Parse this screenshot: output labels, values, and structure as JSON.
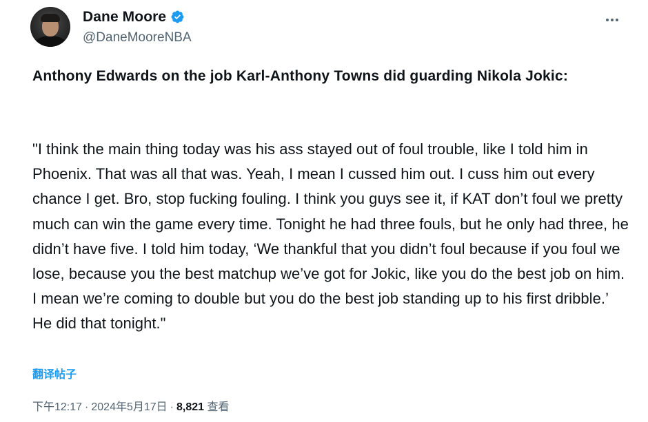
{
  "author": {
    "display_name": "Dane Moore",
    "handle": "@DaneMooreNBA",
    "verified_color": "#1d9bf0"
  },
  "tweet": {
    "headline": "Anthony Edwards on the job Karl-Anthony Towns did guarding Nikola Jokic:",
    "quote": "\"I think the main thing today was his ass stayed out of foul trouble, like I told him in Phoenix. That was all that was. Yeah, I mean I cussed him out. I cuss him out every chance I get. Bro, stop fucking fouling. I think you guys see it, if KAT don’t foul we pretty much can win the game every time. Tonight he had three fouls, but he only had three, he didn’t have five. I told him today, ‘We thankful that you didn’t foul because if you foul we lose, because you the best matchup we’ve got for Jokic, like you do the best job on him. I mean we’re coming to double but you do the best job standing up to his first dribble.’ He did that tonight.\"",
    "translate_label": "翻译帖子"
  },
  "meta": {
    "time": "下午12:17",
    "separator": "·",
    "date": "2024年5月17日",
    "views_count": "8,821",
    "views_label": "查看"
  },
  "icons": {
    "more": "more-horizontal-icon",
    "verified": "verified-badge-icon"
  },
  "colors": {
    "accent": "#1d9bf0",
    "text_primary": "#0f1419",
    "text_secondary": "#536471"
  }
}
